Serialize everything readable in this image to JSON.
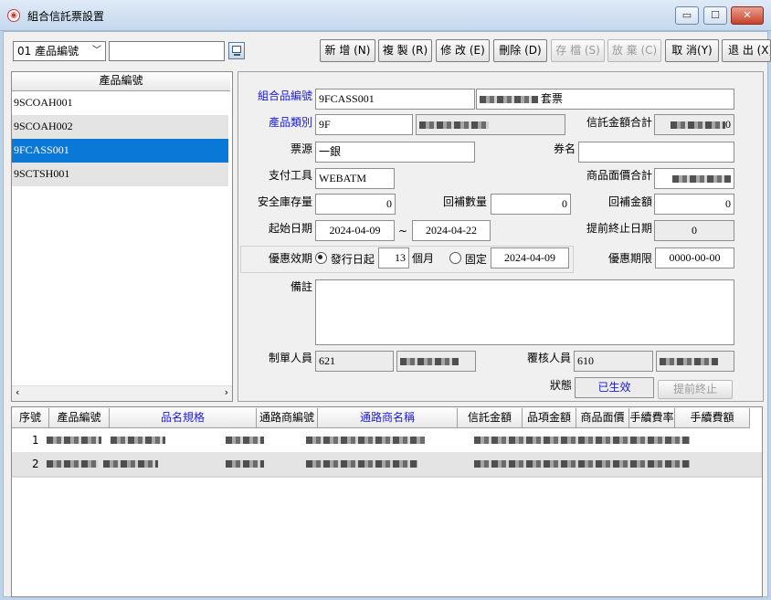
{
  "window": {
    "title": "組合信託票設置",
    "buttons": {
      "minimize": "▭",
      "maximize": "☐",
      "close": "✕"
    }
  },
  "toolbar": {
    "key_select": "01 產品編號",
    "search_value": "",
    "buttons": {
      "add": "新 增 (N)",
      "copy": "複 製 (R)",
      "edit": "修 改 (E)",
      "delete": "刪除 (D)",
      "save": "存 檔 (S)",
      "discard": "放 棄 (C)",
      "cancel": "取 消(Y)",
      "exit": "退 出 (X)"
    }
  },
  "product_list": {
    "header": "產品編號",
    "items": [
      "9SCOAH001",
      "9SCOAH002",
      "9FCASS001",
      "9SCTSH001"
    ],
    "selected_index": 2
  },
  "form": {
    "combo_code": {
      "label": "組合品編號",
      "value": "9FCASS001",
      "name_suffix": "套票"
    },
    "category": {
      "label": "產品類別",
      "value": "9F"
    },
    "trust_total": {
      "label": "信託金額合計",
      "suffix": "0"
    },
    "ticket_source": {
      "label": "票源",
      "value": "一銀"
    },
    "voucher_name": {
      "label": "券名",
      "value": ""
    },
    "payment_tool": {
      "label": "支付工具",
      "value": "WEBATM"
    },
    "face_value_total": {
      "label": "商品面價合計"
    },
    "safety_stock": {
      "label": "安全庫存量",
      "value": "0"
    },
    "refill_qty": {
      "label": "回補數量",
      "value": "0"
    },
    "refill_amount": {
      "label": "回補金額",
      "value": "0"
    },
    "start_date": {
      "label": "起始日期",
      "from": "2024-04-09",
      "sep": "~",
      "to": "2024-04-22"
    },
    "early_end_date": {
      "label": "提前終止日期",
      "value": "0"
    },
    "offer_period": {
      "label": "優惠效期",
      "opt1": "發行日起",
      "months": "13",
      "months_unit": "個月",
      "opt2": "固定",
      "fixed_date": "2024-04-09"
    },
    "offer_deadline": {
      "label": "優惠期限",
      "value": "0000-00-00"
    },
    "remarks": {
      "label": "備註",
      "value": ""
    },
    "creator": {
      "label": "制單人員",
      "value": "621"
    },
    "reviewer": {
      "label": "覆核人員",
      "value": "610"
    },
    "status": {
      "label": "狀態",
      "value": "已生效"
    },
    "early_end_button": "提前終止"
  },
  "grid": {
    "headers": [
      "序號",
      "產品編號",
      "品名規格",
      "通路商編號",
      "通路商名稱",
      "信託金額",
      "品項金額",
      "商品面價",
      "手續費率",
      "手續費額"
    ],
    "rows": [
      {
        "seq": "1"
      },
      {
        "seq": "2"
      }
    ]
  },
  "colors": {
    "label_blue": "#1a1ad8",
    "selection": "#0a78d7",
    "status_text": "#1a1ad8"
  }
}
